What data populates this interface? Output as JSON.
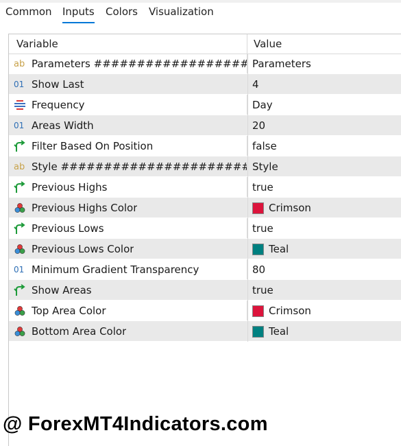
{
  "tabs": [
    {
      "label": "Common",
      "active": false
    },
    {
      "label": "Inputs",
      "active": true
    },
    {
      "label": "Colors",
      "active": false
    },
    {
      "label": "Visualization",
      "active": false
    }
  ],
  "table": {
    "headers": {
      "variable": "Variable",
      "value": "Value"
    },
    "rows": [
      {
        "icon": "ab-string-icon",
        "variable": "Parameters ###################...",
        "value": "Parameters",
        "color": null
      },
      {
        "icon": "integer-icon",
        "variable": "Show Last",
        "value": "4",
        "color": null
      },
      {
        "icon": "enum-icon",
        "variable": "Frequency",
        "value": "Day",
        "color": null
      },
      {
        "icon": "integer-icon",
        "variable": "Areas Width",
        "value": "20",
        "color": null
      },
      {
        "icon": "bool-icon",
        "variable": "Filter Based On Position",
        "value": "false",
        "color": null
      },
      {
        "icon": "ab-string-icon",
        "variable": "Style ########################...",
        "value": "Style",
        "color": null
      },
      {
        "icon": "bool-icon",
        "variable": "Previous Highs",
        "value": "true",
        "color": null
      },
      {
        "icon": "color-icon",
        "variable": "Previous Highs Color",
        "value": "Crimson",
        "color": "#DC143C"
      },
      {
        "icon": "bool-icon",
        "variable": "Previous Lows",
        "value": "true",
        "color": null
      },
      {
        "icon": "color-icon",
        "variable": "Previous Lows Color",
        "value": "Teal",
        "color": "#008080"
      },
      {
        "icon": "integer-icon",
        "variable": "Minimum Gradient Transparency",
        "value": "80",
        "color": null
      },
      {
        "icon": "bool-icon",
        "variable": "Show Areas",
        "value": "true",
        "color": null
      },
      {
        "icon": "color-icon",
        "variable": "Top Area Color",
        "value": "Crimson",
        "color": "#DC143C"
      },
      {
        "icon": "color-icon",
        "variable": "Bottom Area Color",
        "value": "Teal",
        "color": "#008080"
      }
    ]
  },
  "watermark": "@ ForexMT4Indicators.com",
  "colors": {
    "accent": "#0078d7",
    "alt_row": "#e9e9e9"
  }
}
